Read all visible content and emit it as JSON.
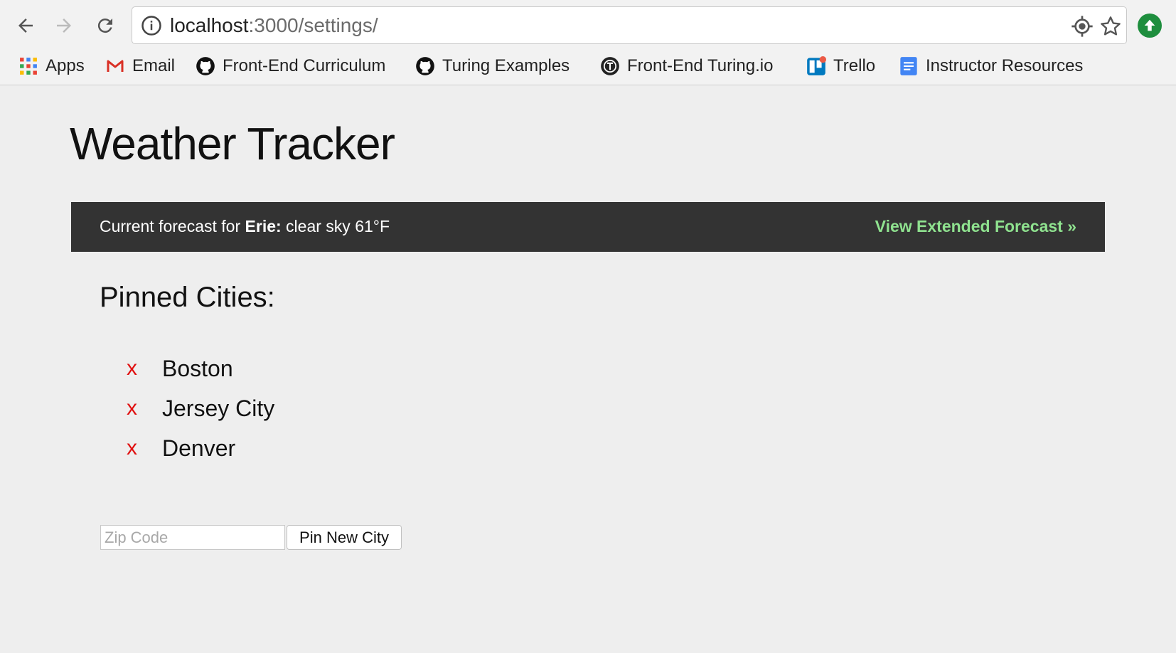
{
  "browser": {
    "url_host": "localhost",
    "url_path": ":3000/settings/",
    "bookmarks": [
      {
        "label": "Apps",
        "icon": "apps-grid-icon"
      },
      {
        "label": "Email",
        "icon": "gmail-icon"
      },
      {
        "label": "Front-End Curriculum",
        "icon": "github-icon"
      },
      {
        "label": "Turing Examples",
        "icon": "github-icon"
      },
      {
        "label": "Front-End Turing.io",
        "icon": "turing-icon"
      },
      {
        "label": "Trello",
        "icon": "trello-icon"
      },
      {
        "label": "Instructor Resources",
        "icon": "google-docs-icon"
      }
    ]
  },
  "app": {
    "title": "Weather Tracker",
    "forecast": {
      "prefix": "Current forecast for ",
      "city": "Erie:",
      "conditions": " clear sky 61°F",
      "link_label": "View Extended Forecast »",
      "link_color": "#8fe28f"
    },
    "pinned": {
      "heading": "Pinned Cities:",
      "remove_symbol": "x",
      "cities": [
        "Boston",
        "Jersey City",
        "Denver"
      ]
    },
    "form": {
      "zip_placeholder": "Zip Code",
      "zip_value": "",
      "submit_label": "Pin New City"
    }
  },
  "colors": {
    "background": "#eeeeee",
    "bar": "#333333",
    "remove": "#e01010"
  }
}
